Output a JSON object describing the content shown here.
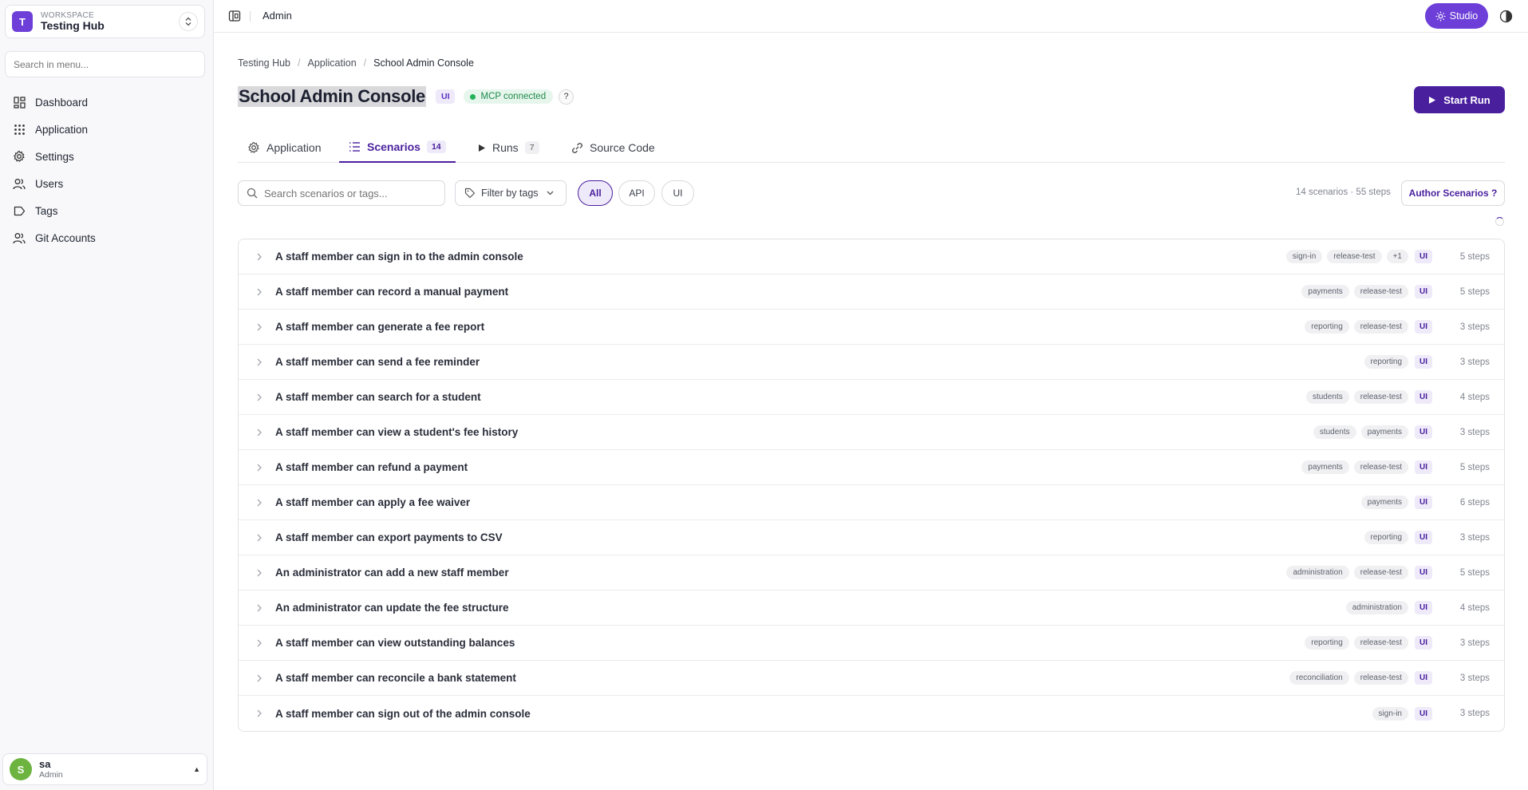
{
  "workspace": {
    "label": "WORKSPACE",
    "name": "Testing Hub",
    "initial": "T"
  },
  "sidebar": {
    "search_placeholder": "Search in menu...",
    "items": [
      {
        "label": "Dashboard",
        "icon": "dashboard-icon"
      },
      {
        "label": "Application",
        "icon": "grid-icon"
      },
      {
        "label": "Settings",
        "icon": "gear-icon"
      },
      {
        "label": "Users",
        "icon": "users-icon"
      },
      {
        "label": "Tags",
        "icon": "tag-icon"
      },
      {
        "label": "Git Accounts",
        "icon": "users-icon"
      }
    ]
  },
  "user": {
    "initial": "S",
    "name": "sa",
    "role": "Admin"
  },
  "topbar": {
    "title": "Admin",
    "studio_label": "Studio"
  },
  "breadcrumb": [
    "Testing Hub",
    "Application",
    "School Admin Console"
  ],
  "page": {
    "title": "School Admin Console",
    "type_badge": "UI",
    "mcp_status": "MCP connected",
    "help": "?",
    "start_run_label": "Start Run"
  },
  "tabs": [
    {
      "label": "Application",
      "count": null,
      "active": false
    },
    {
      "label": "Scenarios",
      "count": "14",
      "active": true
    },
    {
      "label": "Runs",
      "count": "7",
      "active": false
    },
    {
      "label": "Source Code",
      "count": null,
      "active": false
    }
  ],
  "toolbar": {
    "search_placeholder": "Search scenarios or tags...",
    "filter_label": "Filter by tags",
    "pills": [
      "All",
      "API",
      "UI"
    ],
    "active_pill": "All",
    "summary": "14 scenarios · 55 steps",
    "author_label": "Author Scenarios ?"
  },
  "colors": {
    "accent": "#4a1f9e",
    "brand": "#6d3fd8",
    "success": "#22b35a"
  },
  "scenarios": [
    {
      "title": "A staff member can sign in to the admin console",
      "tags": [
        "sign-in",
        "release-test",
        "+1"
      ],
      "type": "UI",
      "steps": "5 steps"
    },
    {
      "title": "A staff member can record a manual payment",
      "tags": [
        "payments",
        "release-test"
      ],
      "type": "UI",
      "steps": "5 steps"
    },
    {
      "title": "A staff member can generate a fee report",
      "tags": [
        "reporting",
        "release-test"
      ],
      "type": "UI",
      "steps": "3 steps"
    },
    {
      "title": "A staff member can send a fee reminder",
      "tags": [
        "reporting"
      ],
      "type": "UI",
      "steps": "3 steps"
    },
    {
      "title": "A staff member can search for a student",
      "tags": [
        "students",
        "release-test"
      ],
      "type": "UI",
      "steps": "4 steps"
    },
    {
      "title": "A staff member can view a student's fee history",
      "tags": [
        "students",
        "payments"
      ],
      "type": "UI",
      "steps": "3 steps"
    },
    {
      "title": "A staff member can refund a payment",
      "tags": [
        "payments",
        "release-test"
      ],
      "type": "UI",
      "steps": "5 steps"
    },
    {
      "title": "A staff member can apply a fee waiver",
      "tags": [
        "payments"
      ],
      "type": "UI",
      "steps": "6 steps"
    },
    {
      "title": "A staff member can export payments to CSV",
      "tags": [
        "reporting"
      ],
      "type": "UI",
      "steps": "3 steps"
    },
    {
      "title": "An administrator can add a new staff member",
      "tags": [
        "administration",
        "release-test"
      ],
      "type": "UI",
      "steps": "5 steps"
    },
    {
      "title": "An administrator can update the fee structure",
      "tags": [
        "administration"
      ],
      "type": "UI",
      "steps": "4 steps"
    },
    {
      "title": "A staff member can view outstanding balances",
      "tags": [
        "reporting",
        "release-test"
      ],
      "type": "UI",
      "steps": "3 steps"
    },
    {
      "title": "A staff member can reconcile a bank statement",
      "tags": [
        "reconciliation",
        "release-test"
      ],
      "type": "UI",
      "steps": "3 steps"
    },
    {
      "title": "A staff member can sign out of the admin console",
      "tags": [
        "sign-in"
      ],
      "type": "UI",
      "steps": "3 steps"
    }
  ]
}
